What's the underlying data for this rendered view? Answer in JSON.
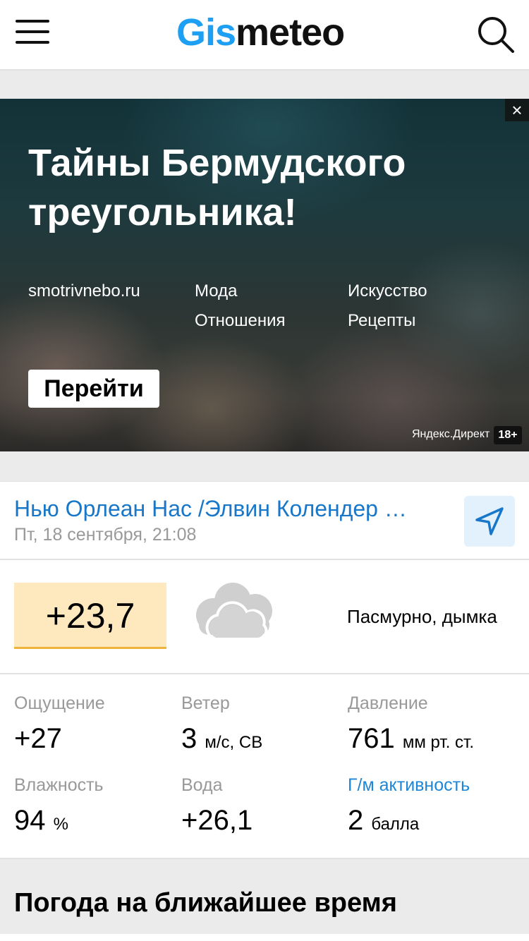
{
  "header": {
    "logo_part1": "Gis",
    "logo_part2": "meteo",
    "menu_icon": "hamburger-menu-icon",
    "search_icon": "search-icon"
  },
  "ad": {
    "title": "Тайны Бермудского треугольника!",
    "links": [
      "smotrivnebo.ru",
      "Мода",
      "Искусство",
      "Отношения",
      "Рецепты"
    ],
    "button_label": "Перейти",
    "source": "Яндекс.Директ",
    "age_badge": "18+",
    "close_icon": "close-icon"
  },
  "location": {
    "name": "Нью Орлеан Нас /Элвин Колендер …",
    "datetime": "Пт, 18 сентября, 21:08",
    "locate_icon": "navigation-arrow-icon",
    "accent_color": "#1877c9"
  },
  "current": {
    "temperature": "+23,7",
    "condition": "Пасмурно, дымка",
    "weather_icon": "cloudy-icon"
  },
  "details": {
    "feels_like": {
      "label": "Ощущение",
      "value": "+27",
      "unit": ""
    },
    "wind": {
      "label": "Ветер",
      "value": "3",
      "unit": "м/с, СВ"
    },
    "pressure": {
      "label": "Давление",
      "value": "761",
      "unit": "мм рт. ст."
    },
    "humidity": {
      "label": "Влажность",
      "value": "94",
      "unit": "%"
    },
    "water": {
      "label": "Вода",
      "value": "+26,1",
      "unit": ""
    },
    "geomagnetic": {
      "label": "Г/м активность",
      "value": "2",
      "unit": "балла"
    }
  },
  "section": {
    "title": "Погода на ближайшее время"
  }
}
